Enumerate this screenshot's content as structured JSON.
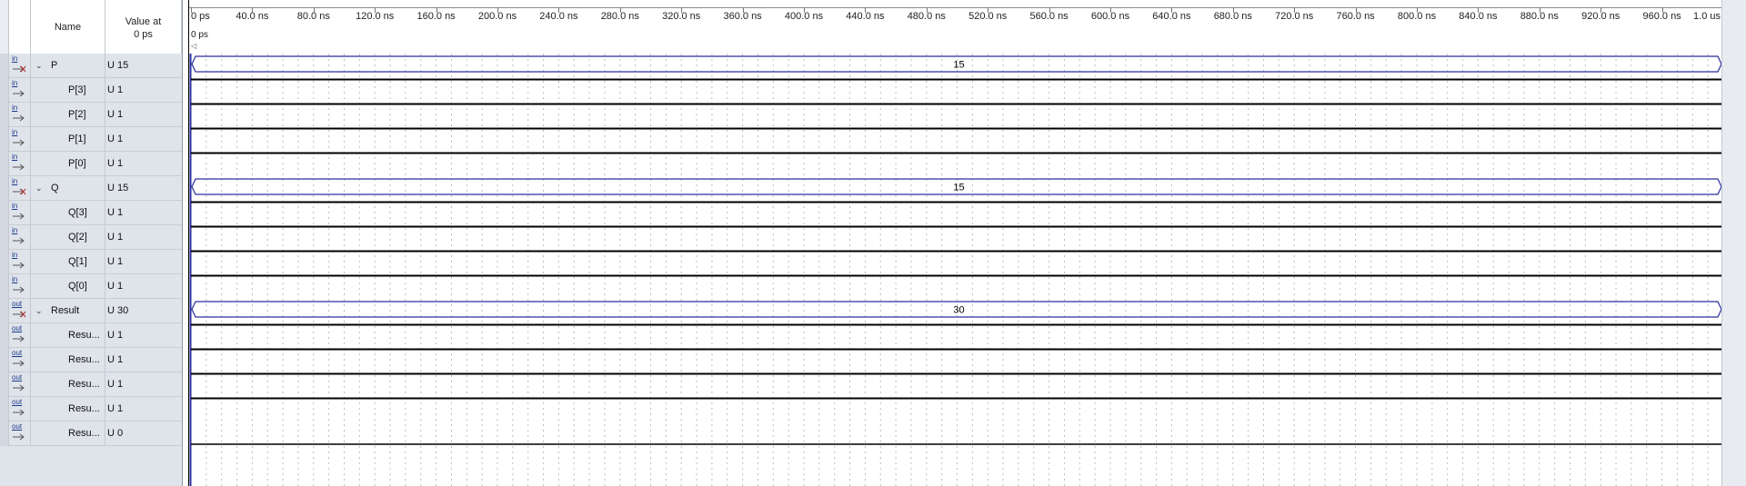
{
  "header": {
    "name_label": "Name",
    "value_label_line1": "Value at",
    "value_label_line2": "0 ps"
  },
  "ruler": {
    "ticks": [
      "0 ps",
      "40.0 ns",
      "80.0 ns",
      "120.0 ns",
      "160.0 ns",
      "200.0 ns",
      "240.0 ns",
      "280.0 ns",
      "320.0 ns",
      "360.0 ns",
      "400.0 ns",
      "440.0 ns",
      "480.0 ns",
      "520.0 ns",
      "560.0 ns",
      "600.0 ns",
      "640.0 ns",
      "680.0 ns",
      "720.0 ns",
      "760.0 ns",
      "800.0 ns",
      "840.0 ns",
      "880.0 ns",
      "920.0 ns",
      "960.0 ns",
      "1.0 us"
    ],
    "cursor_label": "0 ps"
  },
  "signals": [
    {
      "icon": "input-bus-icon",
      "pin": "in",
      "name": "P",
      "value": "U 15",
      "group": true,
      "wave": "bus",
      "bus_label": "15"
    },
    {
      "icon": "input-pin-icon",
      "pin": "in",
      "name": "P[3]",
      "value": "U 1",
      "wave": "high"
    },
    {
      "icon": "input-pin-icon",
      "pin": "in",
      "name": "P[2]",
      "value": "U 1",
      "wave": "high"
    },
    {
      "icon": "input-pin-icon",
      "pin": "in",
      "name": "P[1]",
      "value": "U 1",
      "wave": "high"
    },
    {
      "icon": "input-pin-icon",
      "pin": "in",
      "name": "P[0]",
      "value": "U 1",
      "wave": "high"
    },
    {
      "icon": "input-bus-icon",
      "pin": "in",
      "name": "Q",
      "value": "U 15",
      "group": true,
      "wave": "bus",
      "bus_label": "15"
    },
    {
      "icon": "input-pin-icon",
      "pin": "in",
      "name": "Q[3]",
      "value": "U 1",
      "wave": "high"
    },
    {
      "icon": "input-pin-icon",
      "pin": "in",
      "name": "Q[2]",
      "value": "U 1",
      "wave": "high"
    },
    {
      "icon": "input-pin-icon",
      "pin": "in",
      "name": "Q[1]",
      "value": "U 1",
      "wave": "high"
    },
    {
      "icon": "input-pin-icon",
      "pin": "in",
      "name": "Q[0]",
      "value": "U 1",
      "wave": "high"
    },
    {
      "icon": "output-bus-icon",
      "pin": "out",
      "name": "Result",
      "value": "U 30",
      "group": true,
      "wave": "bus",
      "bus_label": "30"
    },
    {
      "icon": "output-pin-icon",
      "pin": "out",
      "name": "Resu...",
      "value": "U 1",
      "wave": "high"
    },
    {
      "icon": "output-pin-icon",
      "pin": "out",
      "name": "Resu...",
      "value": "U 1",
      "wave": "high"
    },
    {
      "icon": "output-pin-icon",
      "pin": "out",
      "name": "Resu...",
      "value": "U 1",
      "wave": "high"
    },
    {
      "icon": "output-pin-icon",
      "pin": "out",
      "name": "Resu...",
      "value": "U 1",
      "wave": "high"
    },
    {
      "icon": "output-pin-icon",
      "pin": "out",
      "name": "Resu...",
      "value": "U 0",
      "wave": "low"
    }
  ],
  "colors": {
    "bus": "#2b2f9e",
    "wave": "#000000",
    "grid": "#b9bcc4",
    "panel": "#dfe3ea"
  }
}
